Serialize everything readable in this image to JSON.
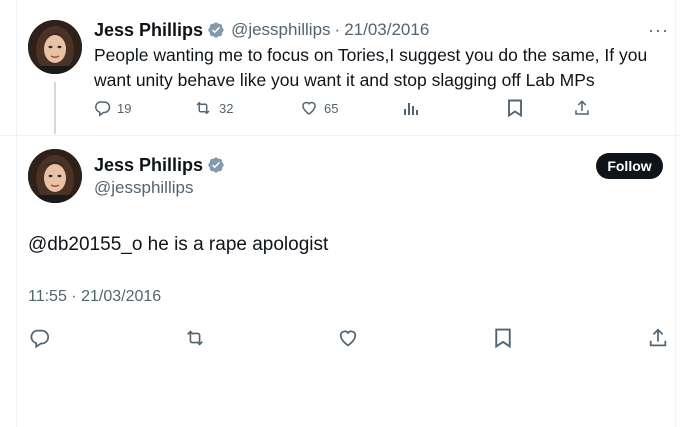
{
  "parent_tweet": {
    "author_name": "Jess Phillips",
    "handle": "@jessphillips",
    "separator": "·",
    "date": "21/03/2016",
    "more": "···",
    "text": "People wanting me to focus on Tories,I suggest you do the same, If you want unity behave like you want it and stop slagging off Lab MPs",
    "reply_count": "19",
    "retweet_count": "32",
    "like_count": "65"
  },
  "main_tweet": {
    "author_name": "Jess Phillips",
    "handle": "@jessphillips",
    "follow_label": "Follow",
    "text": "@db20155_o he is a rape apologist",
    "time": "11:55",
    "separator": "·",
    "date": "21/03/2016"
  },
  "icons": {
    "verified": "verified-badge-icon",
    "reply": "reply-icon",
    "retweet": "retweet-icon",
    "like": "heart-icon",
    "views": "views-icon",
    "bookmark": "bookmark-icon",
    "share": "share-icon"
  },
  "colors": {
    "text": "#0f1419",
    "secondary": "#536471",
    "badge": "#829aab",
    "divider": "#eff3f4",
    "follow_bg": "#0f1419"
  }
}
